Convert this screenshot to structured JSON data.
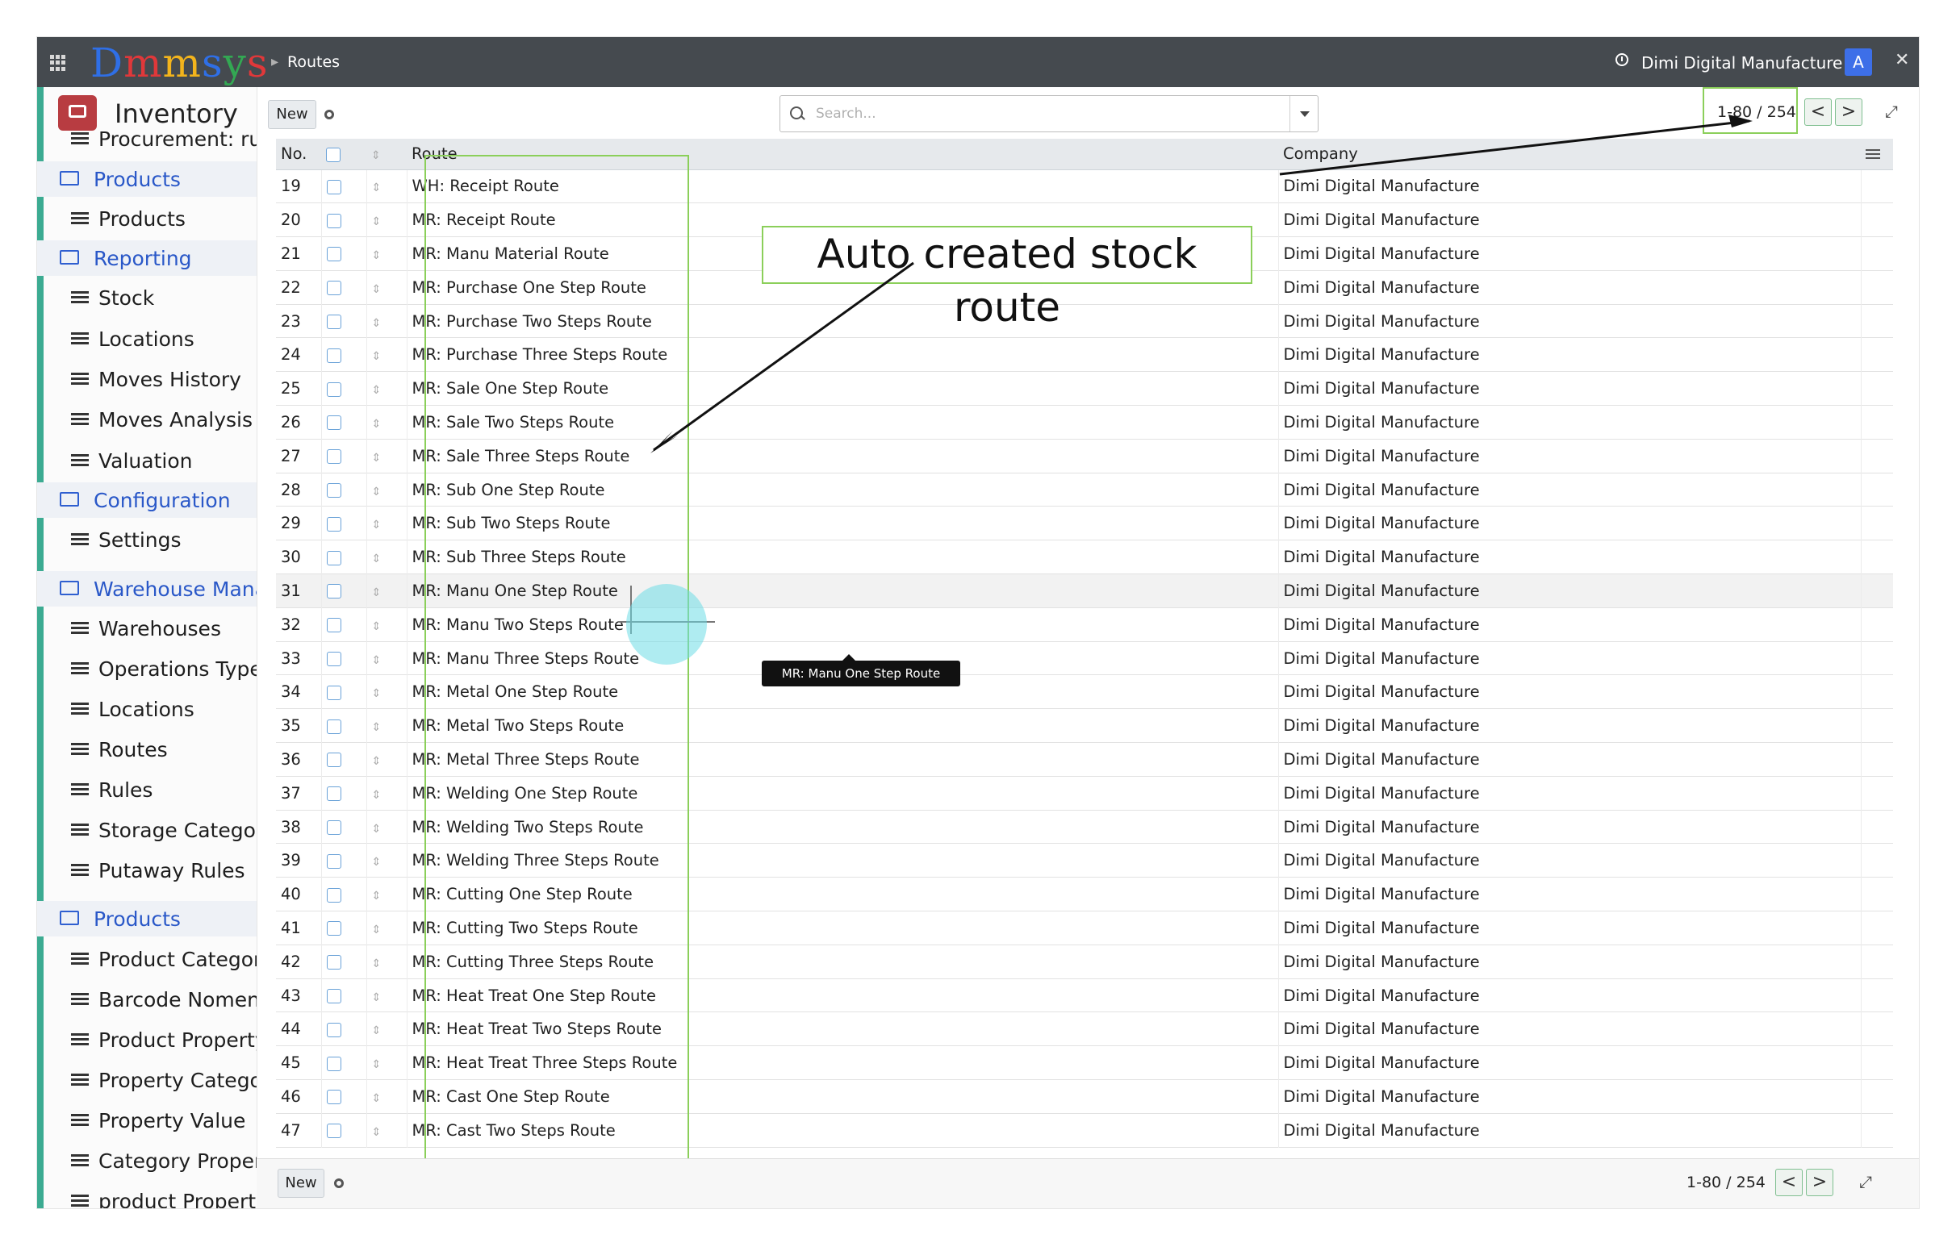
{
  "topbar": {
    "logo": "Dmmsys",
    "breadcrumb": "Routes",
    "company": "Dimi Digital Manufacture",
    "avatar_letter": "A"
  },
  "sidebar": {
    "app_title": "Inventory",
    "items": [
      {
        "label": "Procurement: run",
        "type": "item"
      },
      {
        "label": "Products",
        "type": "section"
      },
      {
        "label": "Products",
        "type": "item"
      },
      {
        "label": "Reporting",
        "type": "section"
      },
      {
        "label": "Stock",
        "type": "item"
      },
      {
        "label": "Locations",
        "type": "item"
      },
      {
        "label": "Moves History",
        "type": "item"
      },
      {
        "label": "Moves Analysis",
        "type": "item"
      },
      {
        "label": "Valuation",
        "type": "item"
      },
      {
        "label": "Configuration",
        "type": "section"
      },
      {
        "label": "Settings",
        "type": "item"
      },
      {
        "label": "Warehouse Manag",
        "type": "section"
      },
      {
        "label": "Warehouses",
        "type": "item"
      },
      {
        "label": "Operations Types",
        "type": "item"
      },
      {
        "label": "Locations",
        "type": "item"
      },
      {
        "label": "Routes",
        "type": "item"
      },
      {
        "label": "Rules",
        "type": "item"
      },
      {
        "label": "Storage Categorie",
        "type": "item"
      },
      {
        "label": "Putaway Rules",
        "type": "item"
      },
      {
        "label": "Products",
        "type": "section"
      },
      {
        "label": "Product Categorie",
        "type": "item"
      },
      {
        "label": "Barcode Nomencl",
        "type": "item"
      },
      {
        "label": "Product Property",
        "type": "item"
      },
      {
        "label": "Property Category",
        "type": "item"
      },
      {
        "label": "Property Value",
        "type": "item"
      },
      {
        "label": "Category Property",
        "type": "item"
      },
      {
        "label": "product Property",
        "type": "item"
      }
    ]
  },
  "controls": {
    "new_label": "New",
    "search_placeholder": "Search...",
    "pager": "1-80 / 254",
    "prev": "<",
    "next": ">"
  },
  "table": {
    "headers": {
      "no": "No.",
      "route": "Route",
      "company": "Company"
    },
    "rows": [
      {
        "no": "19",
        "route": "WH: Receipt Route",
        "company": "Dimi Digital Manufacture"
      },
      {
        "no": "20",
        "route": "MR: Receipt Route",
        "company": "Dimi Digital Manufacture"
      },
      {
        "no": "21",
        "route": "MR: Manu Material Route",
        "company": "Dimi Digital Manufacture"
      },
      {
        "no": "22",
        "route": "MR: Purchase One Step Route",
        "company": "Dimi Digital Manufacture"
      },
      {
        "no": "23",
        "route": "MR: Purchase Two Steps Route",
        "company": "Dimi Digital Manufacture"
      },
      {
        "no": "24",
        "route": "MR: Purchase Three Steps Route",
        "company": "Dimi Digital Manufacture"
      },
      {
        "no": "25",
        "route": "MR: Sale One Step Route",
        "company": "Dimi Digital Manufacture"
      },
      {
        "no": "26",
        "route": "MR: Sale Two Steps Route",
        "company": "Dimi Digital Manufacture"
      },
      {
        "no": "27",
        "route": "MR: Sale Three Steps Route",
        "company": "Dimi Digital Manufacture"
      },
      {
        "no": "28",
        "route": "MR: Sub One Step Route",
        "company": "Dimi Digital Manufacture"
      },
      {
        "no": "29",
        "route": "MR: Sub Two Steps Route",
        "company": "Dimi Digital Manufacture"
      },
      {
        "no": "30",
        "route": "MR: Sub Three Steps Route",
        "company": "Dimi Digital Manufacture"
      },
      {
        "no": "31",
        "route": "MR: Manu One Step Route",
        "company": "Dimi Digital Manufacture"
      },
      {
        "no": "32",
        "route": "MR: Manu Two Steps Route",
        "company": "Dimi Digital Manufacture"
      },
      {
        "no": "33",
        "route": "MR: Manu Three Steps Route",
        "company": "Dimi Digital Manufacture"
      },
      {
        "no": "34",
        "route": "MR: Metal One Step Route",
        "company": "Dimi Digital Manufacture"
      },
      {
        "no": "35",
        "route": "MR: Metal Two Steps Route",
        "company": "Dimi Digital Manufacture"
      },
      {
        "no": "36",
        "route": "MR: Metal Three Steps Route",
        "company": "Dimi Digital Manufacture"
      },
      {
        "no": "37",
        "route": "MR: Welding One Step Route",
        "company": "Dimi Digital Manufacture"
      },
      {
        "no": "38",
        "route": "MR: Welding Two Steps Route",
        "company": "Dimi Digital Manufacture"
      },
      {
        "no": "39",
        "route": "MR: Welding Three Steps Route",
        "company": "Dimi Digital Manufacture"
      },
      {
        "no": "40",
        "route": "MR: Cutting One Step Route",
        "company": "Dimi Digital Manufacture"
      },
      {
        "no": "41",
        "route": "MR: Cutting Two Steps Route",
        "company": "Dimi Digital Manufacture"
      },
      {
        "no": "42",
        "route": "MR: Cutting Three Steps Route",
        "company": "Dimi Digital Manufacture"
      },
      {
        "no": "43",
        "route": "MR: Heat Treat One Step Route",
        "company": "Dimi Digital Manufacture"
      },
      {
        "no": "44",
        "route": "MR: Heat Treat Two Steps Route",
        "company": "Dimi Digital Manufacture"
      },
      {
        "no": "45",
        "route": "MR: Heat Treat Three Steps Route",
        "company": "Dimi Digital Manufacture"
      },
      {
        "no": "46",
        "route": "MR: Cast One Step Route",
        "company": "Dimi Digital Manufacture"
      },
      {
        "no": "47",
        "route": "MR: Cast Two Steps Route",
        "company": "Dimi Digital Manufacture"
      }
    ]
  },
  "annotation": {
    "callout": "Auto created stock route",
    "tooltip": "MR: Manu One Step Route"
  },
  "colors": {
    "topbar": "#454a4f",
    "accent": "#3cab92",
    "highlight": "#8bcf5a",
    "link": "#2a58c8"
  }
}
